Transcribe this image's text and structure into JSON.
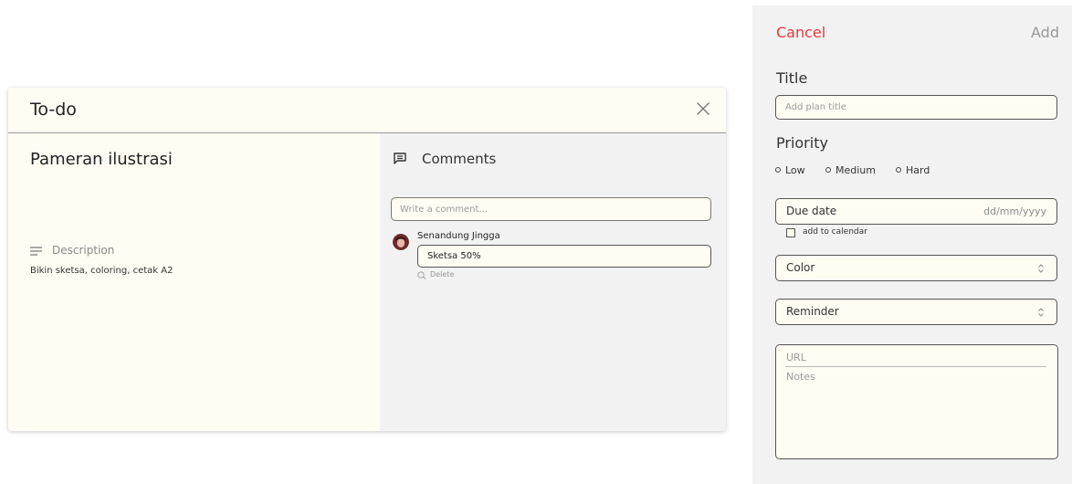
{
  "todo": {
    "header_title": "To-do",
    "task_name": "Pameran ilustrasi",
    "description_label": "Description",
    "description_text": "Bikin sketsa, coloring, cetak A2",
    "comments": {
      "label": "Comments",
      "input_placeholder": "Write a comment...",
      "items": [
        {
          "author": "Senandung Jingga",
          "text": "Sketsa 50%",
          "delete_label": "Delete"
        }
      ]
    }
  },
  "plan_form": {
    "cancel_label": "Cancel",
    "add_label": "Add",
    "title_label": "Title",
    "title_placeholder": "Add plan title",
    "priority_label": "Priority",
    "priority_options": [
      "Low",
      "Medium",
      "Hard"
    ],
    "due_date_label": "Due date",
    "due_date_placeholder": "dd/mm/yyyy",
    "add_to_calendar_label": "add to calendar",
    "color_label": "Color",
    "reminder_label": "Reminder",
    "url_placeholder": "URL",
    "notes_placeholder": "Notes"
  },
  "colors": {
    "card_background": "#fffcf3",
    "panel_background": "#f2f2f3",
    "cancel_accent": "#e5393c",
    "muted_text": "#999999"
  },
  "icons": [
    "close-icon",
    "description-icon",
    "comments-icon",
    "delete-icon",
    "chevron-updown-icon"
  ]
}
